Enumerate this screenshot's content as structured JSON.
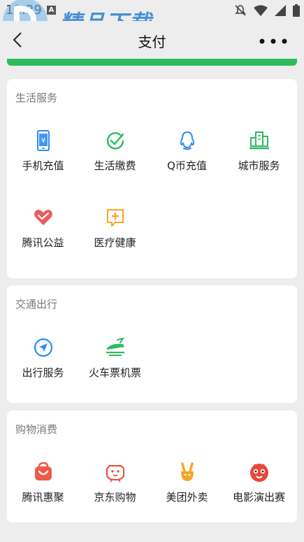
{
  "status_bar": {
    "time": "11:29",
    "a_badge": "A"
  },
  "watermark": {
    "title": "精品下载",
    "url": "www.j9p.com"
  },
  "nav": {
    "title": "支付"
  },
  "sections": [
    {
      "title": "生活服务",
      "items": [
        {
          "label": "手机充值",
          "icon": "mobile-recharge-icon",
          "color": "#2d8cf0"
        },
        {
          "label": "生活缴费",
          "icon": "life-payment-icon",
          "color": "#2dbb61"
        },
        {
          "label": "Q币充值",
          "icon": "qq-coin-icon",
          "color": "#2d8cf0"
        },
        {
          "label": "城市服务",
          "icon": "city-service-icon",
          "color": "#2dbb61"
        },
        {
          "label": "腾讯公益",
          "icon": "tencent-charity-icon",
          "color": "#e85d5d"
        },
        {
          "label": "医疗健康",
          "icon": "medical-health-icon",
          "color": "#f5a623"
        }
      ]
    },
    {
      "title": "交通出行",
      "items": [
        {
          "label": "出行服务",
          "icon": "travel-service-icon",
          "color": "#2d8cf0"
        },
        {
          "label": "火车票机票",
          "icon": "train-ticket-icon",
          "color": "#2dbb61"
        }
      ]
    },
    {
      "title": "购物消费",
      "items": [
        {
          "label": "腾讯惠聚",
          "icon": "tencent-huiju-icon",
          "color": "#f05a4a"
        },
        {
          "label": "京东购物",
          "icon": "jd-shopping-icon",
          "color": "#e8483b"
        },
        {
          "label": "美团外卖",
          "icon": "meituan-takeout-icon",
          "color": "#f5a623"
        },
        {
          "label": "电影演出赛",
          "icon": "movie-show-icon",
          "color": "#e8483b"
        }
      ]
    }
  ]
}
